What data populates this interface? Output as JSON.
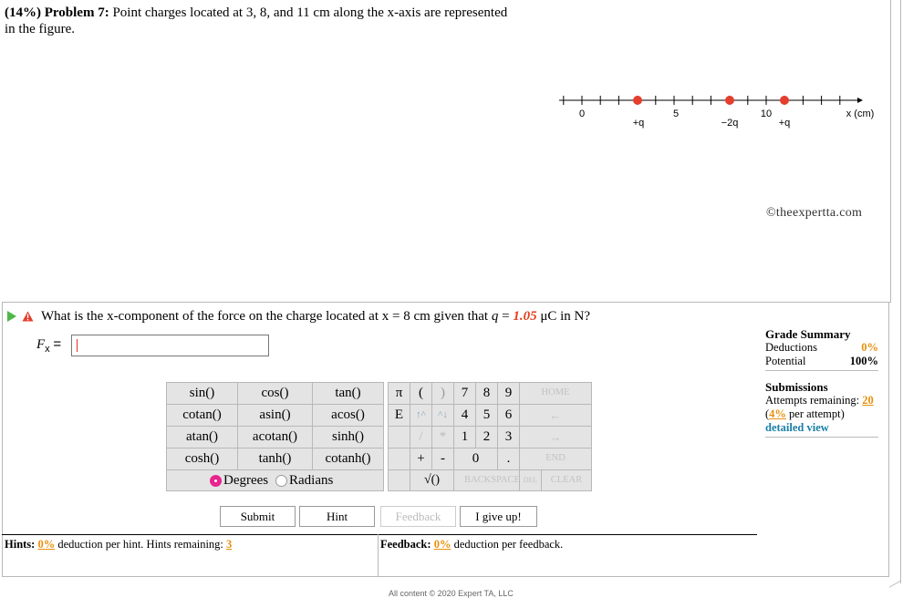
{
  "problem": {
    "weight": "(14%)",
    "number": "Problem 7:",
    "text": "Point charges located at 3, 8, and 11 cm along the x-axis are represented in the figure."
  },
  "figure": {
    "ticks": [
      "0",
      "5",
      "10"
    ],
    "axis_label": "x (cm)",
    "charges": [
      "+q",
      "−2q",
      "+q"
    ],
    "charge_color": "#e53e2e"
  },
  "watermark": "©theexpertta.com",
  "question": {
    "text_before": "What is the x-component of the force on the charge located at x = 8 cm given that",
    "var": "q",
    "equals": "=",
    "value": "1.05",
    "unit": "μC in N?"
  },
  "answer": {
    "label": "F",
    "label_sub": "x",
    "eq": "=",
    "value": ""
  },
  "grade_summary": {
    "title": "Grade Summary",
    "deductions_label": "Deductions",
    "deductions_value": "0%",
    "potential_label": "Potential",
    "potential_value": "100%",
    "submissions_title": "Submissions",
    "attempts_label": "Attempts remaining:",
    "attempts_value": "20",
    "per_attempt_pct": "4%",
    "per_attempt_label": "per attempt)",
    "detailed_view": "detailed view"
  },
  "keypad": {
    "functions": [
      [
        "sin()",
        "cos()",
        "tan()"
      ],
      [
        "cotan()",
        "asin()",
        "acos()"
      ],
      [
        "atan()",
        "acotan()",
        "sinh()"
      ],
      [
        "cosh()",
        "tanh()",
        "cotanh()"
      ]
    ],
    "degrees_label": "Degrees",
    "radians_label": "Radians",
    "pi": "π",
    "open_paren": "(",
    "close_paren": ")",
    "e": "E",
    "up": "↑^",
    "down": "^↓",
    "slash": "/",
    "star": "*",
    "plus": "+",
    "minus": "-",
    "sqrt": "√()",
    "digits_row1": [
      "7",
      "8",
      "9"
    ],
    "digits_row2": [
      "4",
      "5",
      "6"
    ],
    "digits_row3": [
      "1",
      "2",
      "3"
    ],
    "zero": "0",
    "dot": ".",
    "home": "HOME",
    "left_arrow": "←",
    "right_arrow": "→",
    "end": "END",
    "backspace": "BACKSPACE",
    "del": "DEL",
    "clear": "CLEAR"
  },
  "actions": {
    "submit": "Submit",
    "hint": "Hint",
    "feedback": "Feedback",
    "give_up": "I give up!"
  },
  "hints": {
    "label": "Hints:",
    "deduction": "0%",
    "text": "deduction per hint. Hints remaining:",
    "remaining": "3"
  },
  "feedback": {
    "label": "Feedback:",
    "deduction": "0%",
    "text": "deduction per feedback."
  },
  "footer": "All content © 2020 Expert TA, LLC"
}
